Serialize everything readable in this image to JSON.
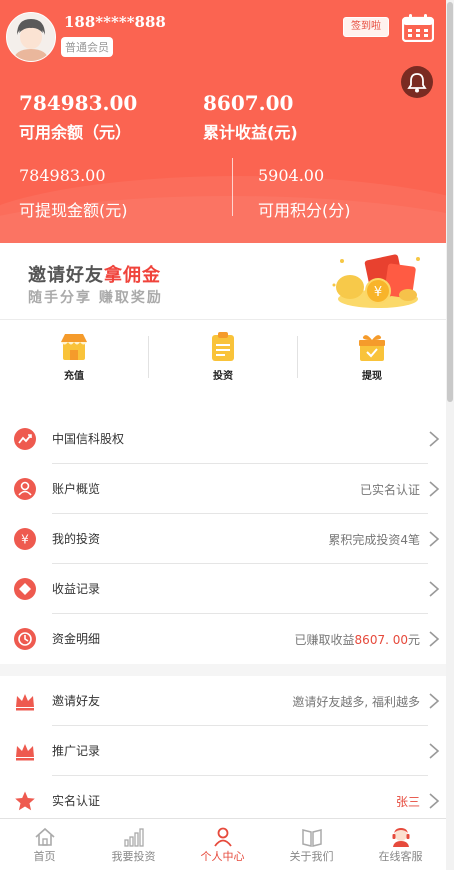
{
  "user": {
    "phone": "188*****888",
    "level": "普通会员",
    "signin_label": "签到啦"
  },
  "balances": {
    "available_value": "784983.00",
    "available_label": "可用余额（元）",
    "total_profit_value": "8607.00",
    "total_profit_label": "累计收益(元)",
    "withdrawable_value": "784983.00",
    "withdrawable_label": "可提现金额(元)",
    "points_value": "5904.00",
    "points_label": "可用积分(分)"
  },
  "banner": {
    "title_part1": "邀请好友",
    "title_part2": "拿佣金",
    "subtitle": "随手分享 赚取奖励"
  },
  "quick_actions": [
    {
      "label": "充值",
      "icon": "shop-icon"
    },
    {
      "label": "投资",
      "icon": "clipboard-icon"
    },
    {
      "label": "提现",
      "icon": "gift-box-icon"
    }
  ],
  "menu": [
    {
      "label": "中国信科股权",
      "value": "",
      "icon": "chart-icon"
    },
    {
      "label": "账户概览",
      "value": "已实名认证",
      "icon": "user-icon"
    },
    {
      "label": "我的投资",
      "value": "累积完成投资4笔",
      "icon": "yen-icon"
    },
    {
      "label": "收益记录",
      "value": "",
      "icon": "diamond-icon"
    },
    {
      "label": "资金明细",
      "value_prefix": "已赚取收益",
      "value_highlight": "8607. 00",
      "value_suffix": "元",
      "icon": "clock-icon"
    },
    {
      "label": "邀请好友",
      "value": "邀请好友越多, 福利越多",
      "icon": "crown-icon"
    },
    {
      "label": "推广记录",
      "value": "",
      "icon": "crown-icon"
    },
    {
      "label": "实名认证",
      "value": "张三",
      "icon": "star-icon"
    }
  ],
  "tabs": [
    {
      "label": "首页",
      "icon": "home-icon"
    },
    {
      "label": "我要投资",
      "icon": "bars-icon"
    },
    {
      "label": "个人中心",
      "icon": "person-icon",
      "active": true
    },
    {
      "label": "关于我们",
      "icon": "book-icon"
    },
    {
      "label": "在线客服",
      "icon": "service-icon"
    }
  ],
  "colors": {
    "header_red": "#fb6451",
    "accent_red": "#e64a3c"
  }
}
